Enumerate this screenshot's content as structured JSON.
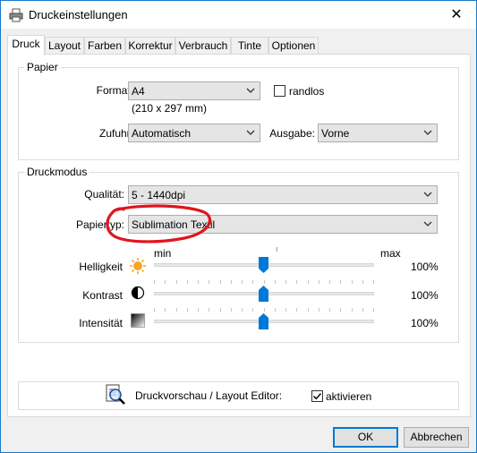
{
  "window": {
    "title": "Druckeinstellungen",
    "close_glyph": "✕"
  },
  "tabs": [
    {
      "label": "Druck",
      "active": true
    },
    {
      "label": "Layout",
      "active": false
    },
    {
      "label": "Farben",
      "active": false
    },
    {
      "label": "Korrektur",
      "active": false
    },
    {
      "label": "Verbrauch",
      "active": false
    },
    {
      "label": "Tinte",
      "active": false
    },
    {
      "label": "Optionen",
      "active": false
    }
  ],
  "paper": {
    "group_label": "Papier",
    "format_label": "Format:",
    "format_value": "A4",
    "format_size": "(210 x 297 mm)",
    "borderless_label": "randlos",
    "borderless_checked": false,
    "feed_label": "Zufuhr:",
    "feed_value": "Automatisch",
    "output_label": "Ausgabe:",
    "output_value": "Vorne"
  },
  "printmode": {
    "group_label": "Druckmodus",
    "quality_label": "Qualität:",
    "quality_value": "5 - 1440dpi",
    "papertype_label": "Papiertyp:",
    "papertype_value": "Sublimation Textil",
    "min_label": "min",
    "max_label": "max",
    "brightness_label": "Helligkeit",
    "brightness_value": "100%",
    "brightness_level": 0.5,
    "contrast_label": "Kontrast",
    "contrast_value": "100%",
    "contrast_level": 0.5,
    "intensity_label": "Intensität",
    "intensity_value": "100%",
    "intensity_level": 0.5
  },
  "preview": {
    "label": "Druckvorschau / Layout Editor:",
    "activate_label": "aktivieren",
    "activate_checked": true
  },
  "buttons": {
    "ok": "OK",
    "cancel": "Abbrechen"
  },
  "colors": {
    "accent": "#0078d7",
    "annotation": "#e0141e",
    "sun": "#f5a623"
  }
}
